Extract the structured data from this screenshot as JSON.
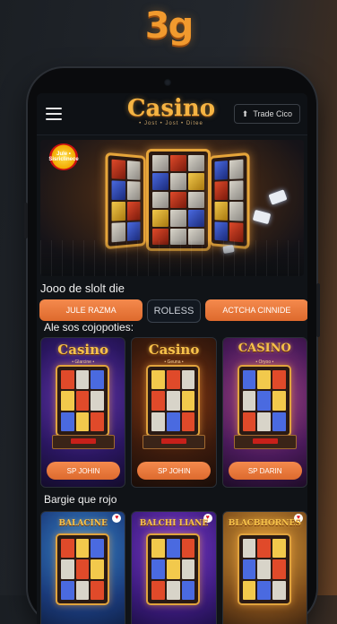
{
  "brand": "3g",
  "header": {
    "logo": "Casino",
    "logo_sub": "• Jost • Jost • Ditee",
    "trade_button": "Trade Cico"
  },
  "hero": {
    "badge": "Jule\n• Sisriclinece",
    "title": "Jooo de slolt die"
  },
  "filters": [
    {
      "label": "JULE RAZMA"
    },
    {
      "label": "ROLESS"
    },
    {
      "label": "ACTCHA CINNIDE"
    }
  ],
  "section1": {
    "title": "Ale sos cojopoties:",
    "cards": [
      {
        "name": "Casino",
        "sub": "• Glarcine •",
        "button": "SP JOHIN"
      },
      {
        "name": "Casino",
        "sub": "• Geuna •",
        "button": "SP JOHIN"
      },
      {
        "name": "CASINO",
        "sub": "• Oryoo •",
        "button": "SP DARIN"
      }
    ]
  },
  "section2": {
    "title": "Bargie que rojo",
    "cards": [
      {
        "name": "BALACINE"
      },
      {
        "name": "BALCHI LIANE"
      },
      {
        "name": "BLACBHORNES"
      }
    ]
  },
  "colors": {
    "accent": "#f48a4d",
    "gold": "#f5b443",
    "background": "#101317"
  }
}
